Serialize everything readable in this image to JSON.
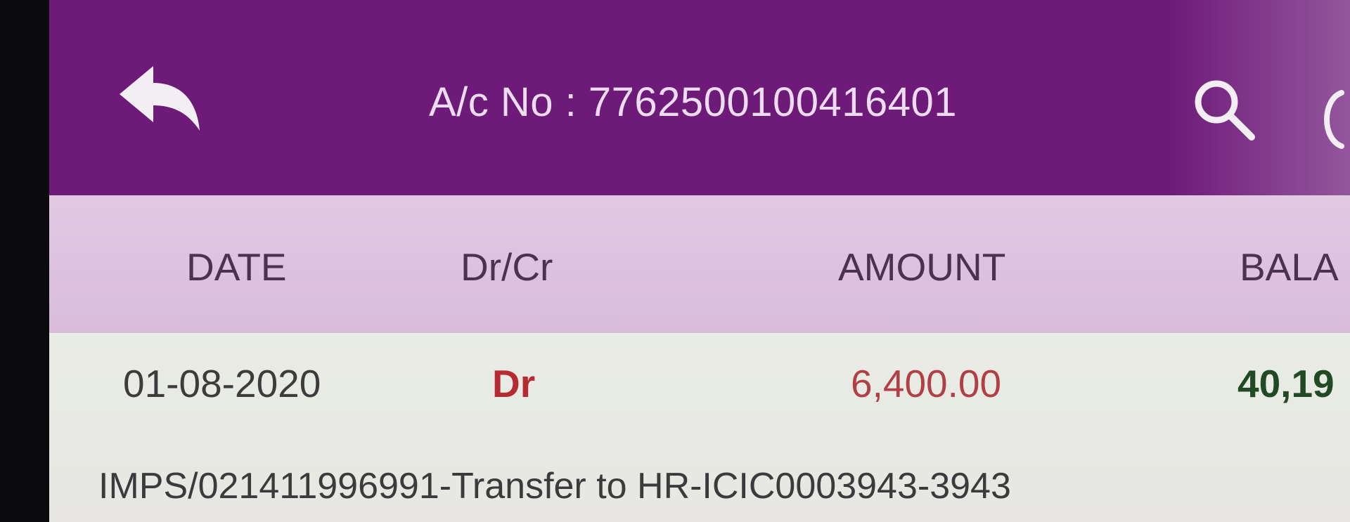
{
  "topbar": {
    "title": "A/c No : 7762500100416401",
    "back_icon": "back-arrow-icon",
    "search_icon": "search-icon",
    "more_icon": "overflow-icon",
    "color": "#6d1a78"
  },
  "table": {
    "columns": [
      "DATE",
      "Dr/Cr",
      "AMOUNT",
      "BALA"
    ],
    "rows": [
      {
        "date": "01-08-2020",
        "type": "Dr",
        "amount": "6,400.00",
        "balance": "40,19",
        "description": "IMPS/021411996991-Transfer to HR-ICIC0003943-3943"
      }
    ]
  },
  "colors": {
    "debit": "#b52b31",
    "balance": "#1f4a23"
  }
}
